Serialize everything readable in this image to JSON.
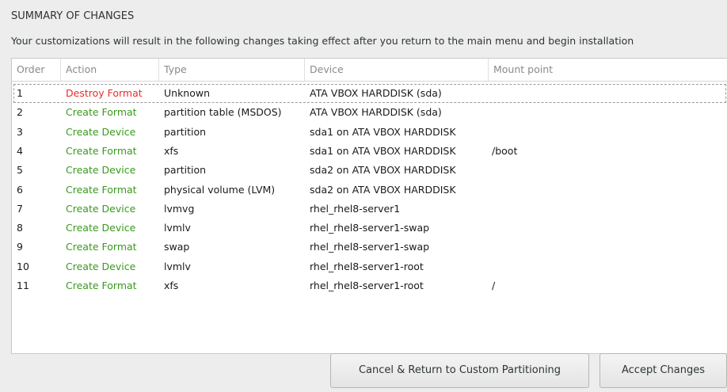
{
  "dialog": {
    "title": "SUMMARY OF CHANGES",
    "subtitle": "Your customizations will result in the following changes taking effect after you return to the main menu and begin installation"
  },
  "table": {
    "columns": [
      "Order",
      "Action",
      "Type",
      "Device",
      "Mount point"
    ],
    "rows": [
      {
        "order": "1",
        "action": "Destroy Format",
        "kind": "destroy",
        "type": "Unknown",
        "device": "ATA VBOX HARDDISK (sda)",
        "mount": ""
      },
      {
        "order": "2",
        "action": "Create Format",
        "kind": "create",
        "type": "partition table (MSDOS)",
        "device": "ATA VBOX HARDDISK (sda)",
        "mount": ""
      },
      {
        "order": "3",
        "action": "Create Device",
        "kind": "create",
        "type": "partition",
        "device": "sda1 on ATA VBOX HARDDISK",
        "mount": ""
      },
      {
        "order": "4",
        "action": "Create Format",
        "kind": "create",
        "type": "xfs",
        "device": "sda1 on ATA VBOX HARDDISK",
        "mount": "/boot"
      },
      {
        "order": "5",
        "action": "Create Device",
        "kind": "create",
        "type": "partition",
        "device": "sda2 on ATA VBOX HARDDISK",
        "mount": ""
      },
      {
        "order": "6",
        "action": "Create Format",
        "kind": "create",
        "type": "physical volume (LVM)",
        "device": "sda2 on ATA VBOX HARDDISK",
        "mount": ""
      },
      {
        "order": "7",
        "action": "Create Device",
        "kind": "create",
        "type": "lvmvg",
        "device": "rhel_rhel8-server1",
        "mount": ""
      },
      {
        "order": "8",
        "action": "Create Device",
        "kind": "create",
        "type": "lvmlv",
        "device": "rhel_rhel8-server1-swap",
        "mount": ""
      },
      {
        "order": "9",
        "action": "Create Format",
        "kind": "create",
        "type": "swap",
        "device": "rhel_rhel8-server1-swap",
        "mount": ""
      },
      {
        "order": "10",
        "action": "Create Device",
        "kind": "create",
        "type": "lvmlv",
        "device": "rhel_rhel8-server1-root",
        "mount": ""
      },
      {
        "order": "11",
        "action": "Create Format",
        "kind": "create",
        "type": "xfs",
        "device": "rhel_rhel8-server1-root",
        "mount": "/"
      }
    ]
  },
  "buttons": {
    "cancel": "Cancel & Return to Custom Partitioning",
    "accept": "Accept Changes"
  },
  "colors": {
    "destroy": "#ef2929",
    "create": "#3a9a1e"
  }
}
